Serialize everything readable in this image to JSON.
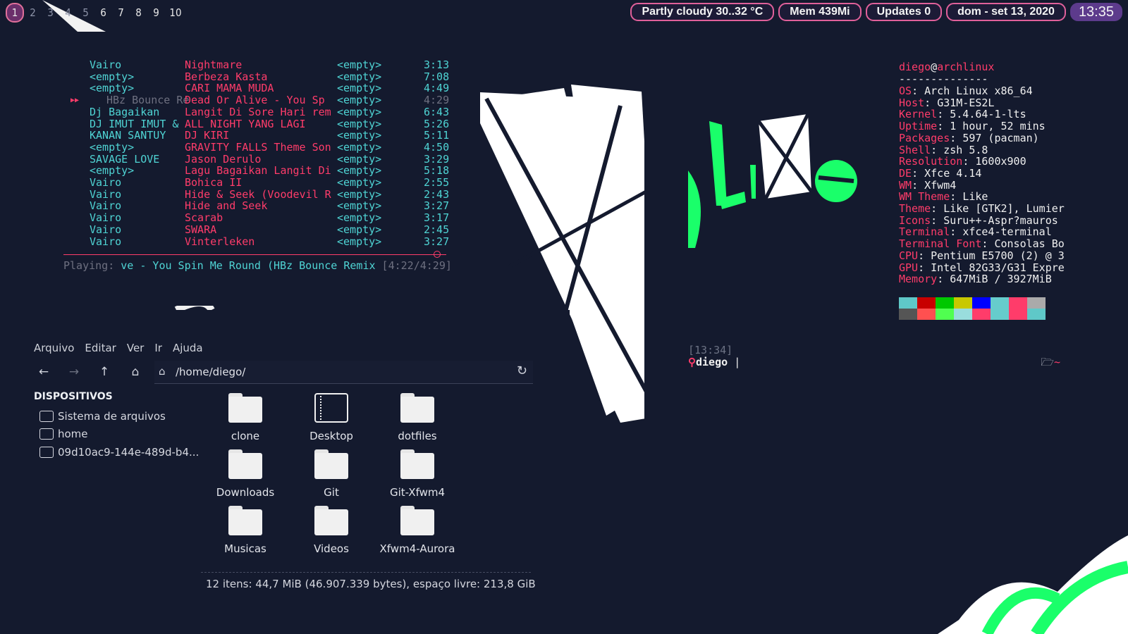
{
  "workspaces": {
    "items": [
      "1",
      "2",
      "3",
      "4",
      "5",
      "6",
      "7",
      "8",
      "9",
      "10"
    ],
    "active": "1"
  },
  "status": {
    "weather": "Partly cloudy 30..32 °C",
    "memory": "Mem 439Mi",
    "updates": "Updates 0",
    "date": "dom - set 13, 2020",
    "time": "13:35"
  },
  "music": {
    "rows": [
      {
        "artist": "Vairo",
        "title": "Nightmare",
        "album": "<empty>",
        "duration": "3:13"
      },
      {
        "artist": "<empty>",
        "title": "Berbeza Kasta",
        "album": "<empty>",
        "duration": "7:08"
      },
      {
        "artist": "<empty>",
        "title": "CARI MAMA MUDA",
        "album": "<empty>",
        "duration": "4:49"
      },
      {
        "artist": "HBz Bounce Re",
        "title": "Dead Or Alive - You Sp",
        "album": "<empty>",
        "duration": "4:29",
        "current": true
      },
      {
        "artist": "Dj Bagaikan",
        "title": "Langit Di Sore Hari rem",
        "album": "<empty>",
        "duration": "6:43"
      },
      {
        "artist": "DJ IMUT IMUT &",
        "title": "ALL NIGHT YANG LAGI",
        "album": "<empty>",
        "duration": "5:26"
      },
      {
        "artist": "KANAN SANTUY",
        "title": "DJ KIRI",
        "album": "<empty>",
        "duration": "5:11"
      },
      {
        "artist": "<empty>",
        "title": "GRAVITY FALLS Theme Son",
        "album": "<empty>",
        "duration": "4:50"
      },
      {
        "artist": "SAVAGE LOVE",
        "title": "Jason Derulo",
        "album": "<empty>",
        "duration": "3:29"
      },
      {
        "artist": "<empty>",
        "title": "Lagu Bagaikan Langit Di",
        "album": "<empty>",
        "duration": "5:18"
      },
      {
        "artist": "Vairo",
        "title": "Bohica II",
        "album": "<empty>",
        "duration": "2:55"
      },
      {
        "artist": "Vairo",
        "title": "Hide & Seek (Voodevil R",
        "album": "<empty>",
        "duration": "2:43"
      },
      {
        "artist": "Vairo",
        "title": "Hide and Seek",
        "album": "<empty>",
        "duration": "3:27"
      },
      {
        "artist": "Vairo",
        "title": "Scarab",
        "album": "<empty>",
        "duration": "3:17"
      },
      {
        "artist": "Vairo",
        "title": "SWARA",
        "album": "<empty>",
        "duration": "2:45"
      },
      {
        "artist": "Vairo",
        "title": "Vinterleken",
        "album": "<empty>",
        "duration": "3:27"
      }
    ],
    "playing_label": "Playing:",
    "playing_track": "ve - You Spin Me Round (HBz Bounce Remix",
    "playing_time": "[4:22/4:29]",
    "progress": 0.975,
    "accent": "#ff3c6a",
    "secondary": "#4fd4d4"
  },
  "filemanager": {
    "menu": [
      "Arquivo",
      "Editar",
      "Ver",
      "Ir",
      "Ajuda"
    ],
    "path": "/home/diego/",
    "devices_heading": "DISPOSITIVOS",
    "devices": [
      "Sistema de arquivos",
      "home",
      "09d10ac9-144e-489d-b4..."
    ],
    "items": [
      {
        "label": "clone",
        "icon": "folder-icon"
      },
      {
        "label": "Desktop",
        "icon": "desktop-folder-icon"
      },
      {
        "label": "dotfiles",
        "icon": "folder-icon"
      },
      {
        "label": "Downloads",
        "icon": "folder-icon"
      },
      {
        "label": "Git",
        "icon": "folder-icon"
      },
      {
        "label": "Git-Xfwm4",
        "icon": "folder-icon"
      },
      {
        "label": "Musicas",
        "icon": "folder-icon"
      },
      {
        "label": "Videos",
        "icon": "folder-icon"
      },
      {
        "label": "Xfwm4-Aurora",
        "icon": "folder-icon"
      }
    ],
    "status": "12 itens: 44,7 MiB (46.907.339 bytes), espaço livre: 213,8 GiB"
  },
  "neofetch": {
    "user": "diego",
    "at": "@",
    "host": "archlinux",
    "separator": "--------------",
    "fields": [
      {
        "key": "OS",
        "value": "Arch Linux x86_64"
      },
      {
        "key": "Host",
        "value": "G31M-ES2L"
      },
      {
        "key": "Kernel",
        "value": "5.4.64-1-lts"
      },
      {
        "key": "Uptime",
        "value": "1 hour, 52 mins"
      },
      {
        "key": "Packages",
        "value": "597 (pacman)"
      },
      {
        "key": "Shell",
        "value": "zsh 5.8"
      },
      {
        "key": "Resolution",
        "value": "1600x900"
      },
      {
        "key": "DE",
        "value": "Xfce 4.14"
      },
      {
        "key": "WM",
        "value": "Xfwm4"
      },
      {
        "key": "WM Theme",
        "value": "Like"
      },
      {
        "key": "Theme",
        "value": "Like [GTK2], Lumier"
      },
      {
        "key": "Icons",
        "value": "Suru++-Aspr?mauros"
      },
      {
        "key": "Terminal",
        "value": "xfce4-terminal"
      },
      {
        "key": "Terminal Font",
        "value": "Consolas Bo"
      },
      {
        "key": "CPU",
        "value": "Pentium E5700 (2) @ 3"
      },
      {
        "key": "GPU",
        "value": "Intel 82G33/G31 Expre"
      },
      {
        "key": "Memory",
        "value": "647MiB / 3927MiB"
      }
    ],
    "palette": [
      "#5fc8c8",
      "#c80000",
      "#00c800",
      "#c8c800",
      "#0000ff",
      "#66cccc",
      "#ff3c6a",
      "#aaaaaa",
      "#555555",
      "#ff5050",
      "#50ff50",
      "#99dddd",
      "#ff3c6a",
      "#66cccc",
      "#ff3c6a",
      "#5fc8c8"
    ],
    "prompt_time": "[13:34]",
    "prompt_user": "diego",
    "prompt_dir": "~"
  },
  "theme": {
    "background": "#141a2e",
    "green": "#1aff6a",
    "pink": "#e0609a"
  }
}
